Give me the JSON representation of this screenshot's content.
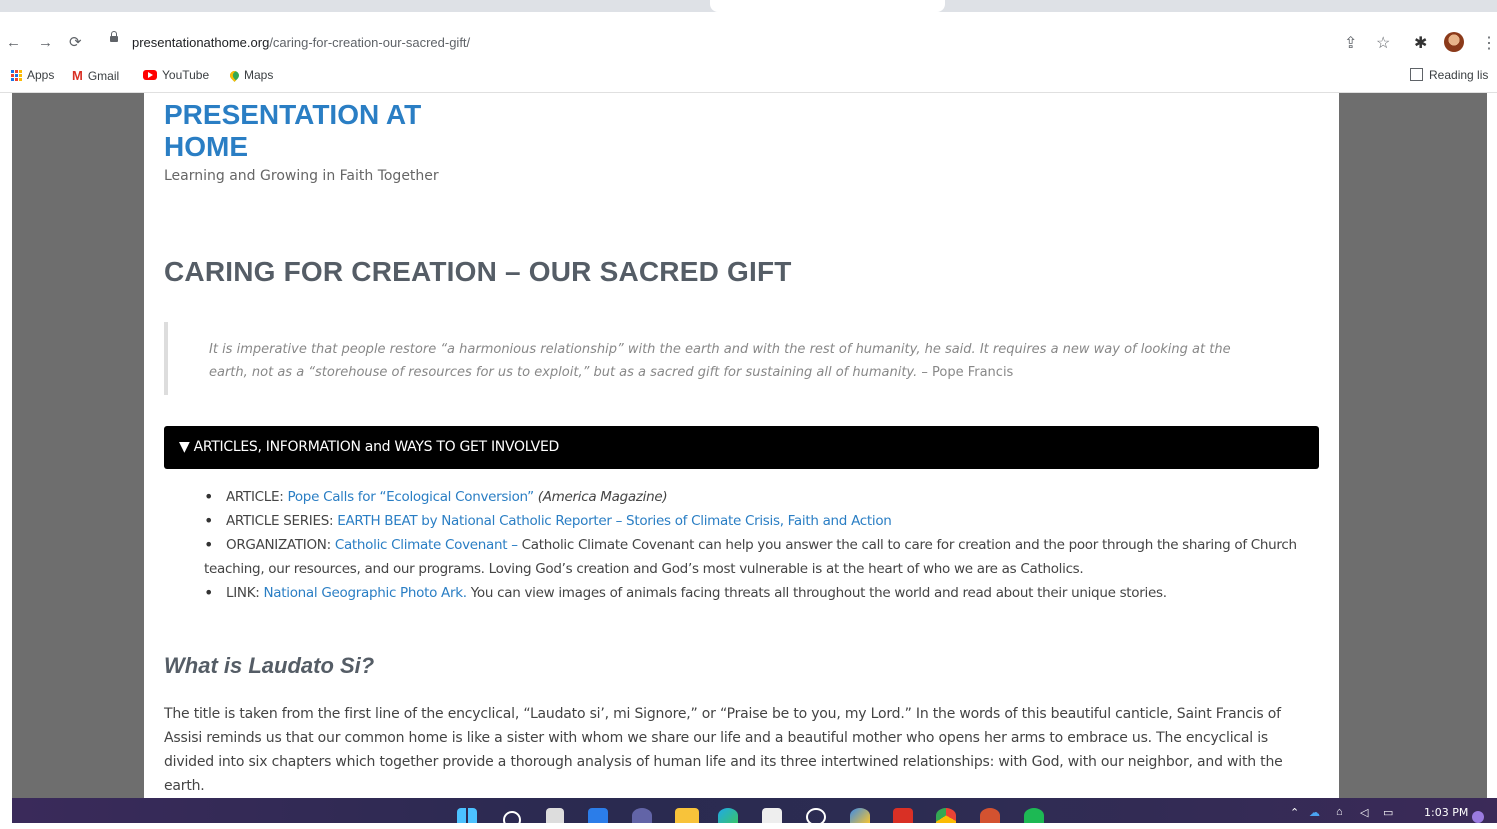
{
  "browser": {
    "url_host": "presentationathome.org",
    "url_path": "/caring-for-creation-our-sacred-gift/",
    "bookmarks": [
      "Apps",
      "Gmail",
      "YouTube",
      "Maps"
    ],
    "reading_list_label": "Reading lis"
  },
  "site": {
    "title": "PRESENTATION AT HOME",
    "tagline": "Learning and Growing in Faith Together"
  },
  "page": {
    "title": "CARING FOR CREATION – OUR SACRED GIFT",
    "quote_italic": "It is imperative that people restore “a harmonious relationship” with the earth and with the rest of humanity, he said. It requires a new way of looking at the earth, not as a “storehouse of resources for us to exploit,” but as a sacred gift for sustaining all of humanity.",
    "quote_attribution": " – Pope Francis",
    "accordion_label": "▼ ARTICLES, INFORMATION and WAYS TO GET INVOLVED",
    "items": [
      {
        "prefix": "ARTICLE: ",
        "link": "Pope Calls for “Ecological Conversion”",
        "suffix": " (America Magazine)"
      },
      {
        "prefix": "ARTICLE SERIES: ",
        "link": "EARTH BEAT by National Catholic Reporter – Stories of Climate Crisis, Faith and Action",
        "suffix": ""
      },
      {
        "prefix": "ORGANIZATION: ",
        "link": "Catholic Climate Covenant –",
        "suffix": " Catholic Climate Covenant can help you answer the call to care for creation and the poor through the sharing of Church",
        "cont": "teaching, our resources, and our programs. Loving God’s creation and God’s most vulnerable is at the heart of who we are as Catholics."
      },
      {
        "prefix": "LINK: ",
        "link": "National Geographic Photo Ark.",
        "suffix": " You can view images of animals facing threats all throughout the world and read about their unique stories."
      }
    ],
    "section_heading": "What is Laudato Si?",
    "section_paragraph": "The title is taken from the first line of the encyclical, “Laudato si’, mi Signore,” or “Praise be to you, my Lord.” In the words of this beautiful canticle, Saint Francis of Assisi reminds us that our common home is like a sister with whom we share our life and a beautiful mother who opens her arms to embrace us. The encyclical is divided into six chapters which together provide a thorough analysis of human life and its three intertwined relationships: with God, with our neighbor, and with the earth."
  },
  "taskbar": {
    "clock": "1:03 PM"
  },
  "colors": {
    "link": "#2a7ec4",
    "heading": "#555d66",
    "accordion_bg": "#000000"
  }
}
